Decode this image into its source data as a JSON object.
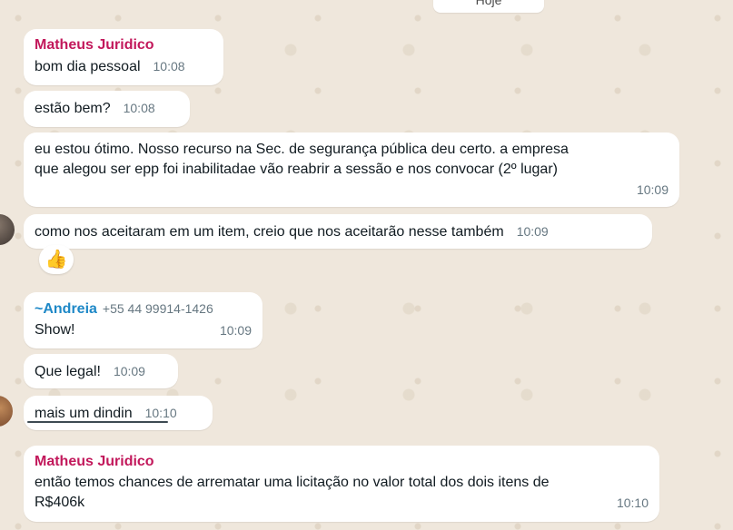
{
  "chat": {
    "date_chip": "Hoje",
    "messages": [
      {
        "sender": "Matheus Juridico",
        "text": "bom dia pessoal",
        "time": "10:08"
      },
      {
        "text": "estão bem?",
        "time": "10:08"
      },
      {
        "text_line1": "eu estou ótimo. Nosso recurso na Sec. de segurança pública deu certo. a empresa",
        "text_line2": "que alegou ser epp foi inabilitadae vão reabrir a sessão e nos convocar (2º lugar)",
        "time": "10:09"
      },
      {
        "text": "como nos aceitaram em um item, creio que nos aceitarão nesse também",
        "time": "10:09",
        "reaction": "👍"
      },
      {
        "sender_prefix": "~",
        "sender": "Andreia",
        "phone": "+55 44 99914-1426",
        "text": "Show!",
        "time": "10:09"
      },
      {
        "text": "Que legal!",
        "time": "10:09"
      },
      {
        "text": "mais um dindin",
        "time": "10:10"
      },
      {
        "sender": "Matheus Juridico",
        "text_line1": "então temos chances de arrematar uma licitação no valor total dos dois itens de",
        "text_line2": "R$406k",
        "time": "10:10"
      }
    ]
  },
  "colors": {
    "background": "#efe7dc",
    "bubble": "#ffffff",
    "sender_pink": "#c2185b",
    "sender_blue": "#1e88c7",
    "timestamp": "#667781"
  }
}
